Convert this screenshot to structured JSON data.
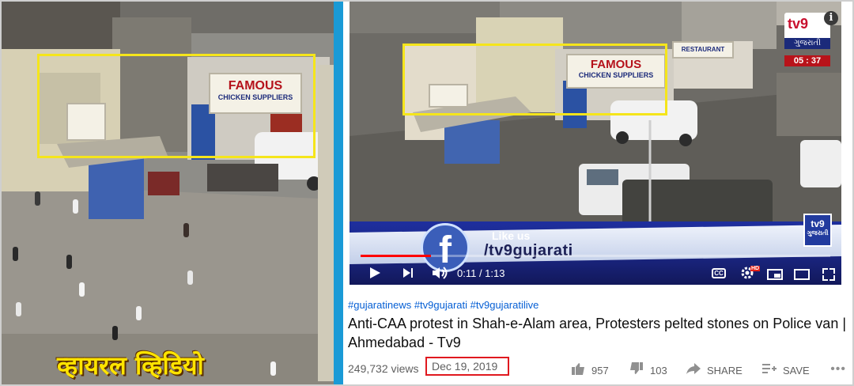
{
  "left_panel": {
    "caption": "व्हायरल व्हिडियो",
    "signs": {
      "main": "FAMOUS",
      "sub": "CHICKEN SUPPLIERS"
    }
  },
  "player": {
    "logo_text": "tv9",
    "logo_sub": "ગુજરાતી",
    "logo_time": "05 : 37",
    "info": "i",
    "fb_letter": "f",
    "fb_like": "Like us",
    "fb_handle": "/tv9gujarati",
    "corner_text": "tv9",
    "corner_sub": "ગુજરાતી",
    "time_current": "0:11",
    "time_total": "1:13",
    "time_readout": "0:11 / 1:13",
    "progress_fraction": 0.15,
    "cc_label": "CC",
    "hd_label": "HD",
    "signs": {
      "main": "FAMOUS",
      "sub": "CHICKEN SUPPLIERS",
      "shop": "RESTAURANT"
    }
  },
  "meta": {
    "hashtags": "#gujaratinews #tv9gujarati #tv9gujaratilive",
    "title": "Anti-CAA protest in Shah-e-Alam area, Protesters pelted stones on Police van | Ahmedabad - Tv9",
    "views": "249,732 views",
    "date": "Dec 19, 2019",
    "likes": "957",
    "dislikes": "103",
    "share": "SHARE",
    "save": "SAVE"
  },
  "colors": {
    "divider": "#1a9ad6",
    "highlight": "#f5e51b",
    "date_box": "#e0191f",
    "progress": "#ff0000",
    "link": "#065fd4"
  }
}
